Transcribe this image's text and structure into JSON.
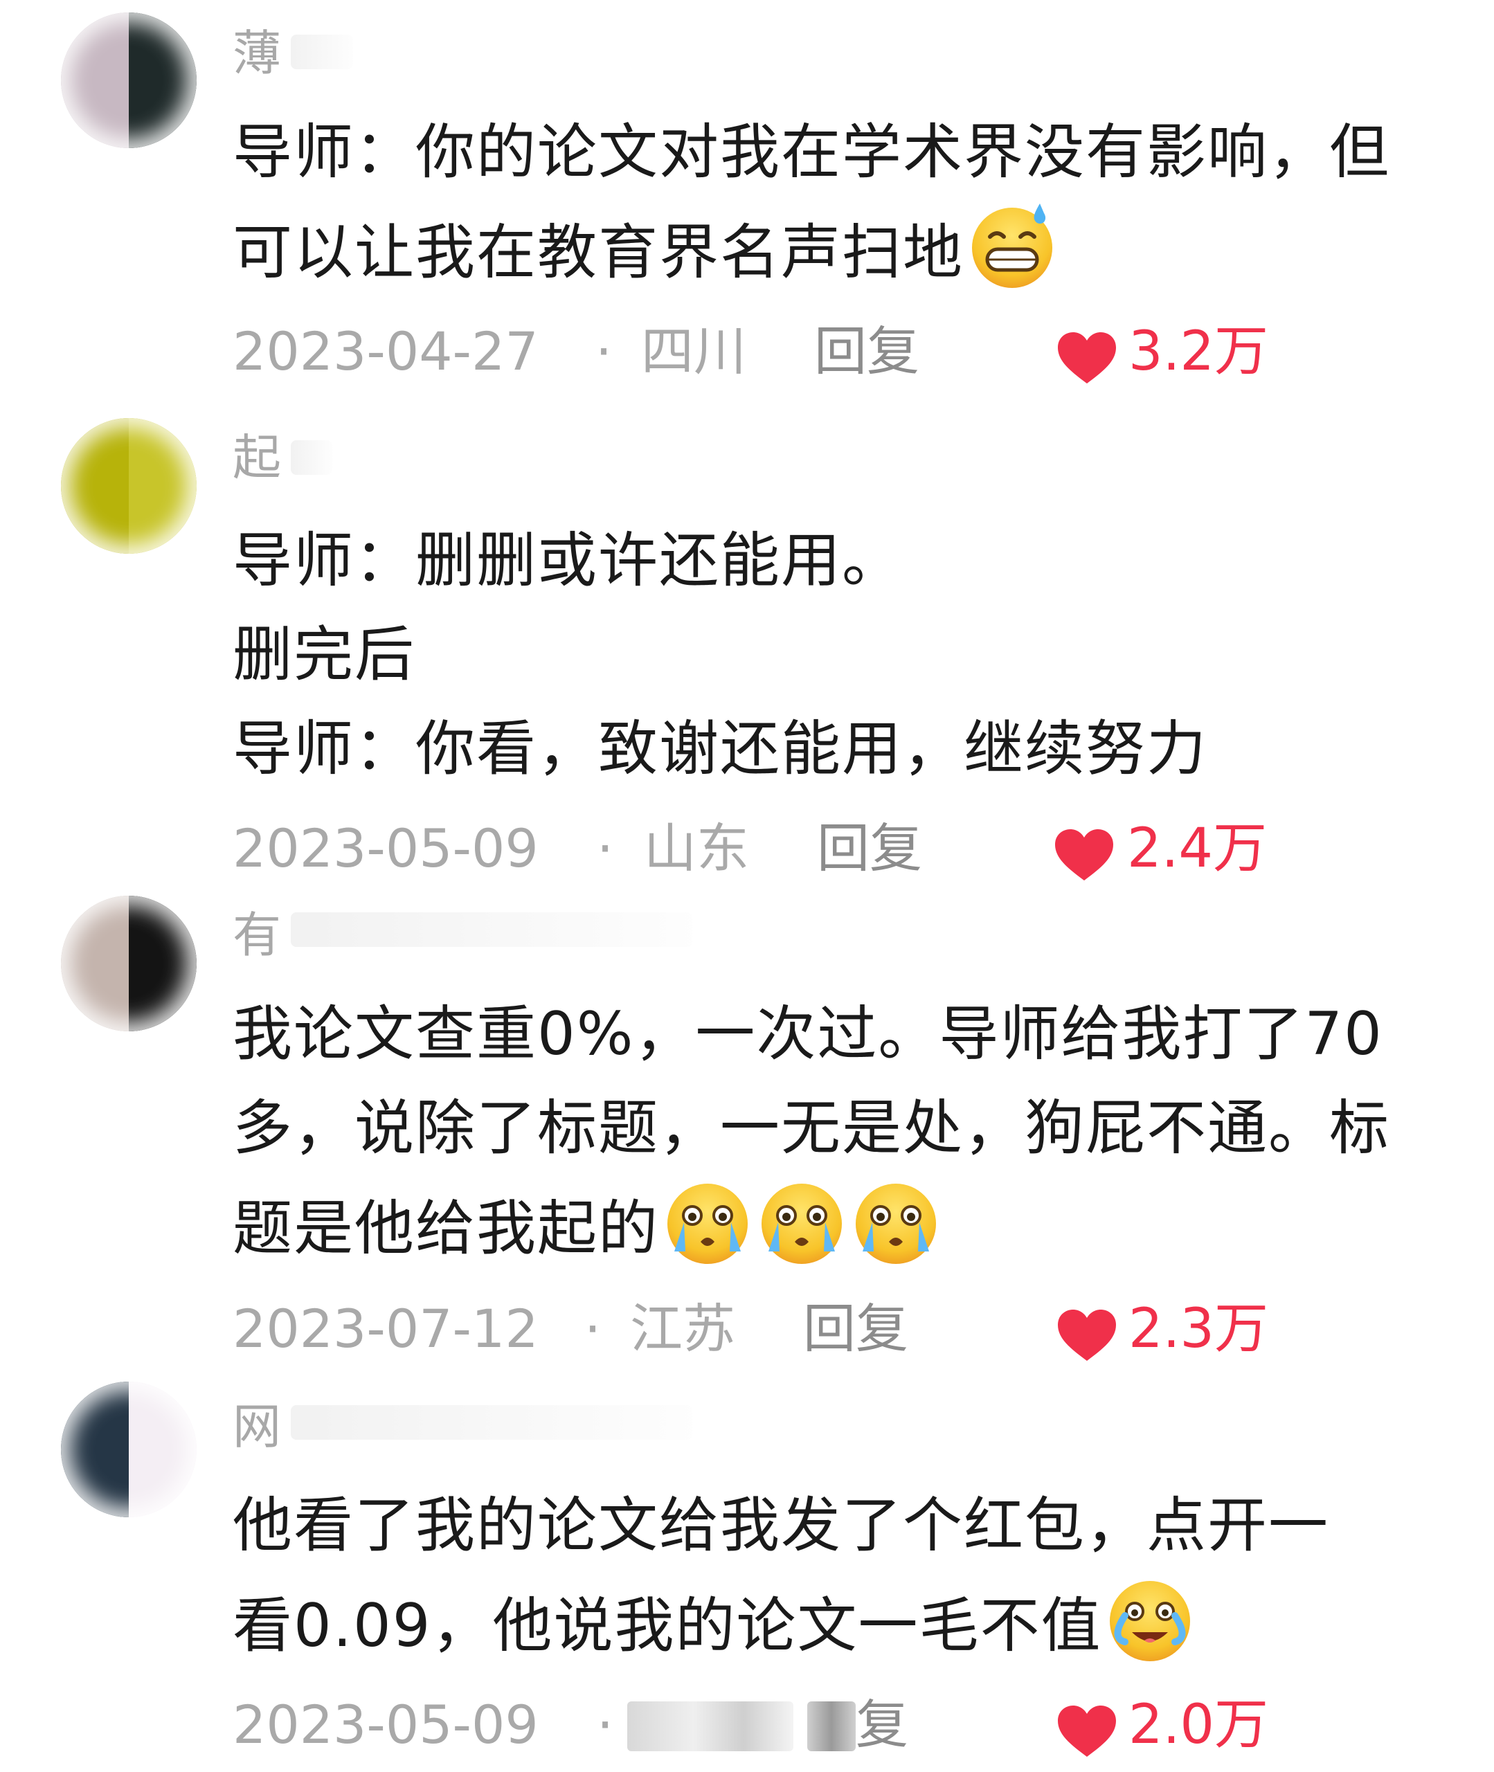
{
  "comments": [
    {
      "username": "薄",
      "avatar_colors": [
        "#c7b8c2",
        "#1f2a2a"
      ],
      "lines": [
        "导师：你的论文对我在学术界没有影响，但",
        "可以让我在教育界名声扫地"
      ],
      "emoji": "grin-sweat-emoji",
      "date": "2023-04-27",
      "location": "四川",
      "reply_label": "回复",
      "likes": "3.2万"
    },
    {
      "username": "起",
      "avatar_colors": [
        "#b7b30a",
        "#c8c52a"
      ],
      "lines": [
        "导师：删删或许还能用。",
        "删完后",
        "导师：你看，致谢还能用，继续努力"
      ],
      "date": "2023-05-09",
      "location": "山东",
      "reply_label": "回复",
      "likes": "2.4万"
    },
    {
      "username": "有",
      "avatar_colors": [
        "#c4b4ad",
        "#141414"
      ],
      "lines": [
        "我论文查重0%，一次过。导师给我打了70",
        "多，说除了标题，一无是处，狗屁不通。标",
        "题是他给我起的"
      ],
      "emoji": "crying-emoji",
      "date": "2023-07-12",
      "location": "江苏",
      "reply_label": "回复",
      "likes": "2.3万"
    },
    {
      "username": "网",
      "avatar_colors": [
        "#253646",
        "#f4eef4"
      ],
      "lines": [
        "他看了我的论文给我发了个红包，点开一",
        "看0.09，他说我的论文一毛不值"
      ],
      "emoji": "laugh-cry-emoji",
      "date": "2023-05-09",
      "reply_label": "复",
      "likes": "2.0万"
    }
  ],
  "colors": {
    "like_red": "#f0304a",
    "meta_gray": "#a9a9a9",
    "text": "#1a1a1a"
  }
}
